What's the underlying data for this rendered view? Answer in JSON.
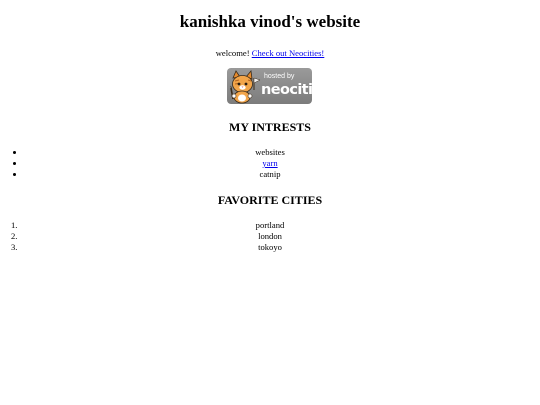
{
  "header": {
    "title": "kanishka vinod's website"
  },
  "welcome": {
    "text": "welcome!",
    "link_label": "Check out Neocities!"
  },
  "badge": {
    "hosted_text": "hosted by",
    "brand_text": "neocities",
    "icon": "neocities-cat-icon"
  },
  "interests": {
    "heading": "MY INTRESTS",
    "items": [
      {
        "label": "websites",
        "link": false
      },
      {
        "label": "yarn",
        "link": true
      },
      {
        "label": "catnip",
        "link": false
      }
    ]
  },
  "cities": {
    "heading": "FAVORITE CITIES",
    "items": [
      {
        "marker": "1.",
        "label": "portland"
      },
      {
        "marker": "2.",
        "label": "london"
      },
      {
        "marker": "3.",
        "label": "tokoyo"
      }
    ]
  }
}
